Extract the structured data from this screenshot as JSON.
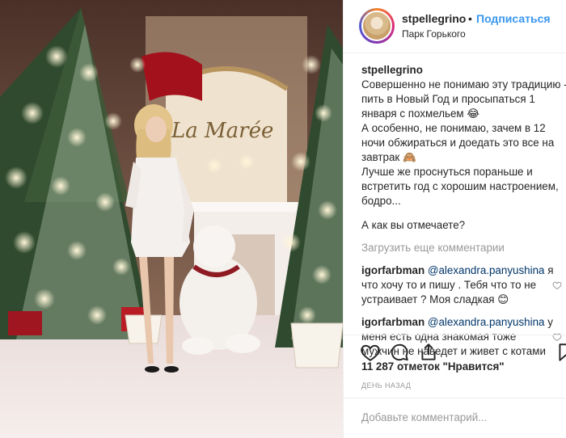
{
  "post": {
    "username": "stpellegrino",
    "separator": "•",
    "follow_label": "Подписаться",
    "location": "Парк Горького",
    "photo_sign": "La Marée"
  },
  "caption": {
    "username": "stpellegrino",
    "lines": [
      "Совершенно не понимаю эту традицию -",
      "пить в Новый Год и просыпаться 1",
      "января с похмельем 😂",
      "А особенно, не понимаю, зачем в 12",
      "ночи обжираться и доедать это все на",
      "завтрак 🙈",
      "Лучше же проснуться пораньше и",
      "встретить год с хорошим настроением,",
      "бодро...",
      "",
      "А как вы отмечаете?"
    ]
  },
  "load_more_label": "Загрузить еще комментарии",
  "comments": [
    {
      "username": "igorfarbman",
      "mention": "@alexandra.panyushina",
      "first_tail": " я",
      "lines": [
        "что хочу то и пишу . Тебя что то не",
        "устраивает ? Моя сладкая 😊"
      ]
    },
    {
      "username": "igorfarbman",
      "mention": "@alexandra.panyushina",
      "first_tail": " у",
      "lines": [
        "меня есть одна знакомая тоже",
        "мужчин не наведет и живет с котами"
      ]
    }
  ],
  "icons": {
    "like": "heart-icon",
    "comment": "comment-icon",
    "share": "share-icon",
    "save": "bookmark-icon"
  },
  "likes_label": "11 287 отметок \"Нравится\"",
  "time_ago": "ДЕНЬ НАЗАД",
  "add_comment_placeholder": "Добавьте комментарий...",
  "colors": {
    "accent": "#3897f0",
    "mention": "#003569",
    "muted": "#999999",
    "text": "#262626"
  }
}
